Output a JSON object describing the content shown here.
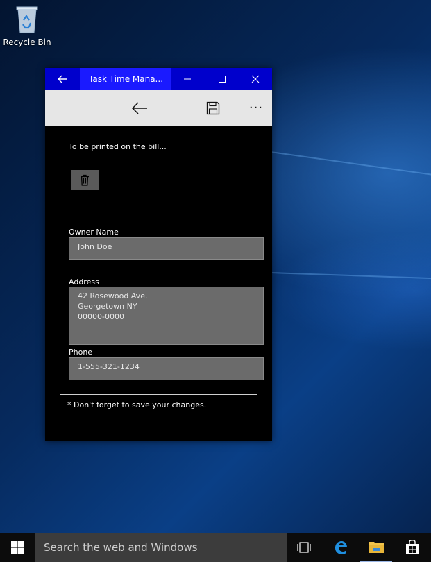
{
  "desktop": {
    "recycle_bin_label": "Recycle Bin"
  },
  "window": {
    "title": "Task Time Mana...",
    "colors": {
      "titlebar": "#0000cc",
      "title_highlight": "#1a1aff",
      "command_bar": "#e6e6e6",
      "field_bg": "#6b6b6b"
    }
  },
  "command_bar": {
    "icons": [
      "back-arrow-icon",
      "save-icon",
      "more-icon"
    ],
    "more_label": "···"
  },
  "form": {
    "hint": "To be printed on the bill...",
    "owner_label": "Owner Name",
    "owner_value": "John Doe",
    "address_label": "Address",
    "address_value": "42 Rosewood Ave.\nGeorgetown NY\n00000-0000",
    "phone_label": "Phone",
    "phone_value": "1-555-321-1234",
    "note": "* Don't forget to save your changes."
  },
  "taskbar": {
    "search_placeholder": "Search the web and Windows",
    "icons": [
      "windows-start-icon",
      "task-view-icon",
      "edge-icon",
      "file-explorer-icon",
      "store-icon"
    ]
  }
}
